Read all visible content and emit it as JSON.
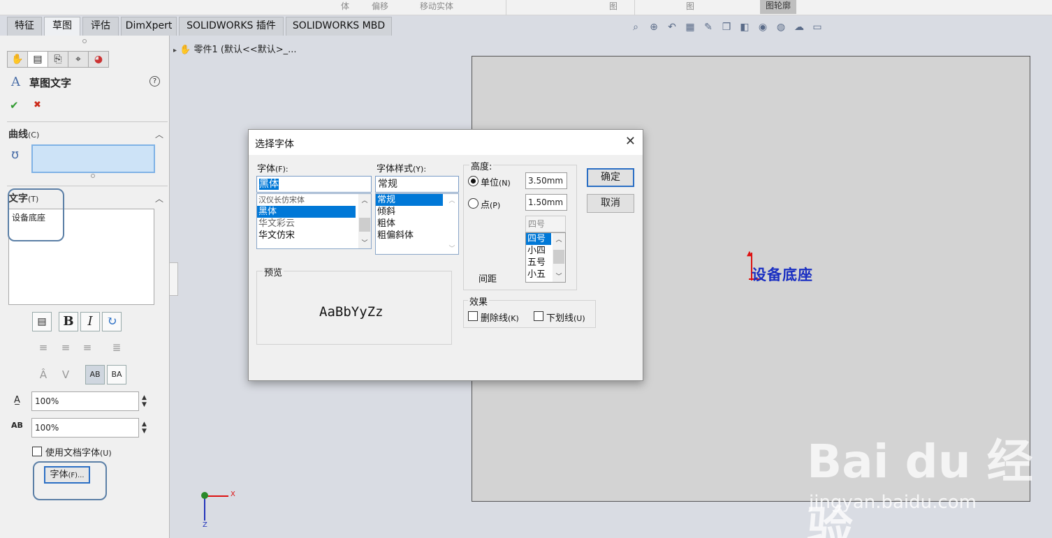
{
  "topbar": {
    "fragments": [
      "体",
      "偏移",
      "移动实体",
      "图",
      "图",
      "图轮廓"
    ]
  },
  "tabs": [
    "特征",
    "草图",
    "评估",
    "DimXpert",
    "SOLIDWORKS 插件",
    "SOLIDWORKS MBD"
  ],
  "active_tab": "草图",
  "breadcrumb": "零件1 (默认<<默认>_...",
  "property_manager": {
    "title": "草图文字",
    "ok_icon": "✔",
    "cancel_icon": "✖",
    "help_icon": "?",
    "curves_section": "曲线",
    "curves_key": "(C)",
    "text_section": "文字",
    "text_key": "(T)",
    "text_value": "设备底座",
    "width_factor": "100%",
    "spacing": "100%",
    "use_doc_font_label": "使用文档字体",
    "use_doc_font_key": "(U)",
    "use_doc_font_checked": false,
    "font_button_label": "字体",
    "font_button_key": "(F)..."
  },
  "format_buttons": [
    "B",
    "I"
  ],
  "dialog": {
    "title": "选择字体",
    "font_label": "字体",
    "font_key": "(F):",
    "font_value": "黑体",
    "font_list": [
      "汉仪长仿宋体",
      "黑体",
      "华文彩云",
      "华文仿宋"
    ],
    "font_selected": "黑体",
    "style_label": "字体样式",
    "style_key": "(Y):",
    "style_value": "常规",
    "style_list": [
      "常规",
      "倾斜",
      "粗体",
      "粗偏斜体"
    ],
    "style_selected": "常规",
    "height_label": "高度:",
    "unit_label": "单位",
    "unit_key": "(N)",
    "unit_value": "3.50mm",
    "unit_selected": true,
    "point_label": "点",
    "point_key": "(P)",
    "point_value": "1.50mm",
    "size_value": "四号",
    "size_list": [
      "四号",
      "小四",
      "五号",
      "小五"
    ],
    "size_selected": "四号",
    "spacing_label": "间距",
    "preview_label": "预览",
    "preview_text": "AaBbYyZz",
    "effects_label": "效果",
    "strike_label": "删除线",
    "strike_key": "(K)",
    "strike_checked": false,
    "underline_label": "下划线",
    "underline_key": "(U)",
    "underline_checked": false,
    "ok_label": "确定",
    "cancel_label": "取消"
  },
  "canvas": {
    "sketch_text": "设备底座",
    "axis_x": "X",
    "axis_z": "Z"
  },
  "watermark": {
    "logo": "Bai du 经验",
    "url": "jingyan.baidu.com"
  },
  "colors": {
    "sketch_text": "#1a2fc2",
    "selection": "#0078d7",
    "callout": "#5b7fa6"
  }
}
